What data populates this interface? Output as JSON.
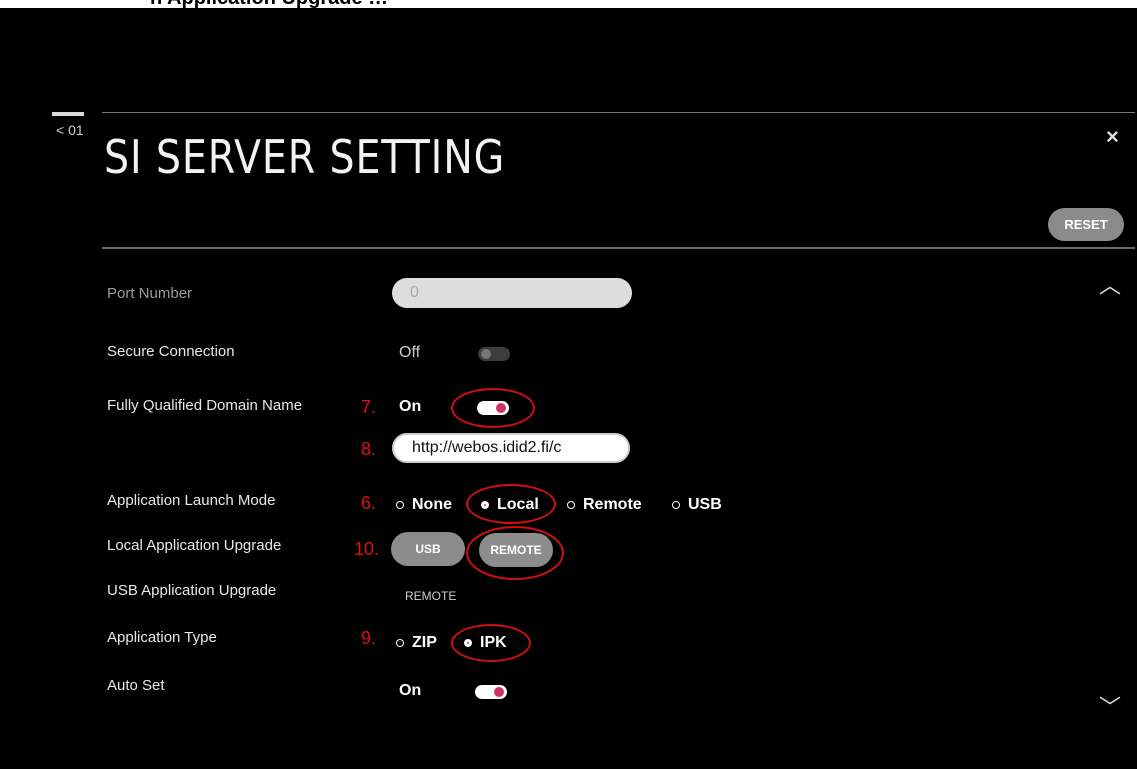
{
  "page": {
    "top_text": "n Application Upgrade …",
    "page_number": "< 01",
    "title": "SI SERVER SETTING",
    "close_label": "×",
    "reset_label": "RESET",
    "scroll_up": "︿",
    "scroll_down": "﹀"
  },
  "settings": {
    "port_number": {
      "label": "Port Number",
      "value": "0"
    },
    "secure_connection": {
      "label": "Secure Connection",
      "state": "Off"
    },
    "fqdn": {
      "label": "Fully Qualified Domain Name",
      "state": "On",
      "url": "http://webos.idid2.fi/c"
    },
    "launch_mode": {
      "label": "Application Launch Mode",
      "options": [
        "None",
        "Local",
        "Remote",
        "USB"
      ],
      "selected": "Local"
    },
    "local_upgrade": {
      "label": "Local Application Upgrade",
      "buttons": [
        "USB",
        "REMOTE"
      ]
    },
    "usb_upgrade": {
      "label": "USB Application Upgrade",
      "button": "REMOTE"
    },
    "app_type": {
      "label": "Application Type",
      "options": [
        "ZIP",
        "IPK"
      ],
      "selected": "IPK"
    },
    "auto_set": {
      "label": "Auto Set",
      "state": "On"
    }
  },
  "annotations": {
    "step7": "7.",
    "step8": "8.",
    "step6": "6.",
    "step10": "10.",
    "step9": "9."
  },
  "colors": {
    "accent": "#d0306a",
    "annotation": "#e01010",
    "background": "#000000"
  }
}
